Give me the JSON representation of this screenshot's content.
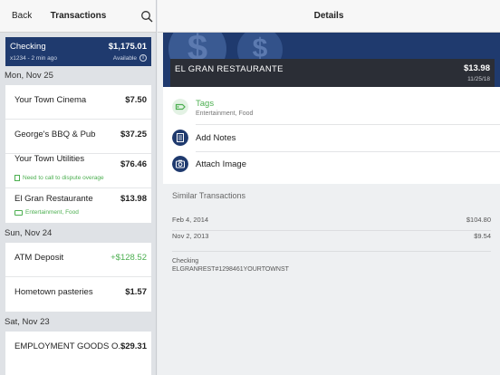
{
  "left": {
    "back": "Back",
    "title": "Transactions",
    "account": {
      "name": "Checking",
      "balance": "$1,175.01",
      "sub": "x1234 - 2 min ago",
      "available": "Available"
    },
    "groups": [
      {
        "date": "Mon, Nov 25",
        "items": [
          {
            "desc": "Your Town Cinema",
            "amount": "$7.50"
          },
          {
            "desc": "George's BBQ & Pub",
            "amount": "$37.25"
          },
          {
            "desc": "Your Town Utilities",
            "amount": "$76.46",
            "note": "Need to call to dispute overage"
          },
          {
            "desc": "El Gran Restaurante",
            "amount": "$13.98",
            "tags": "Entertainment, Food"
          }
        ]
      },
      {
        "date": "Sun, Nov 24",
        "items": [
          {
            "desc": "ATM Deposit",
            "amount": "+$128.52"
          },
          {
            "desc": "Hometown pasteries",
            "amount": "$1.57"
          }
        ]
      },
      {
        "date": "Sat, Nov 23",
        "items": [
          {
            "desc": "EMPLOYMENT GOODS O...",
            "amount": "$29.31"
          }
        ]
      }
    ]
  },
  "right": {
    "title": "Details",
    "txn": {
      "merchant": "EL GRAN RESTAURANTE",
      "amount": "$13.98",
      "date": "11/25/18"
    },
    "actions": {
      "tags_label": "Tags",
      "tags_value": "Entertainment, Food",
      "notes_label": "Add Notes",
      "image_label": "Attach Image"
    },
    "similar_header": "Similar Transactions",
    "similar": [
      {
        "date": "Feb 4, 2014",
        "amount": "$104.80"
      },
      {
        "date": "Nov 2, 2013",
        "amount": "$9.54"
      }
    ],
    "account_line1": "Checking",
    "account_line2": "ELGRANREST#1298461YOURTOWNST"
  },
  "colors": {
    "navy": "#1f3a6e",
    "green": "#4caf50",
    "dark_bar": "#2b2e36"
  },
  "icons": [
    "search-icon",
    "info-icon",
    "note-icon",
    "tag-icon",
    "notes-icon",
    "camera-icon",
    "coin-icon"
  ]
}
